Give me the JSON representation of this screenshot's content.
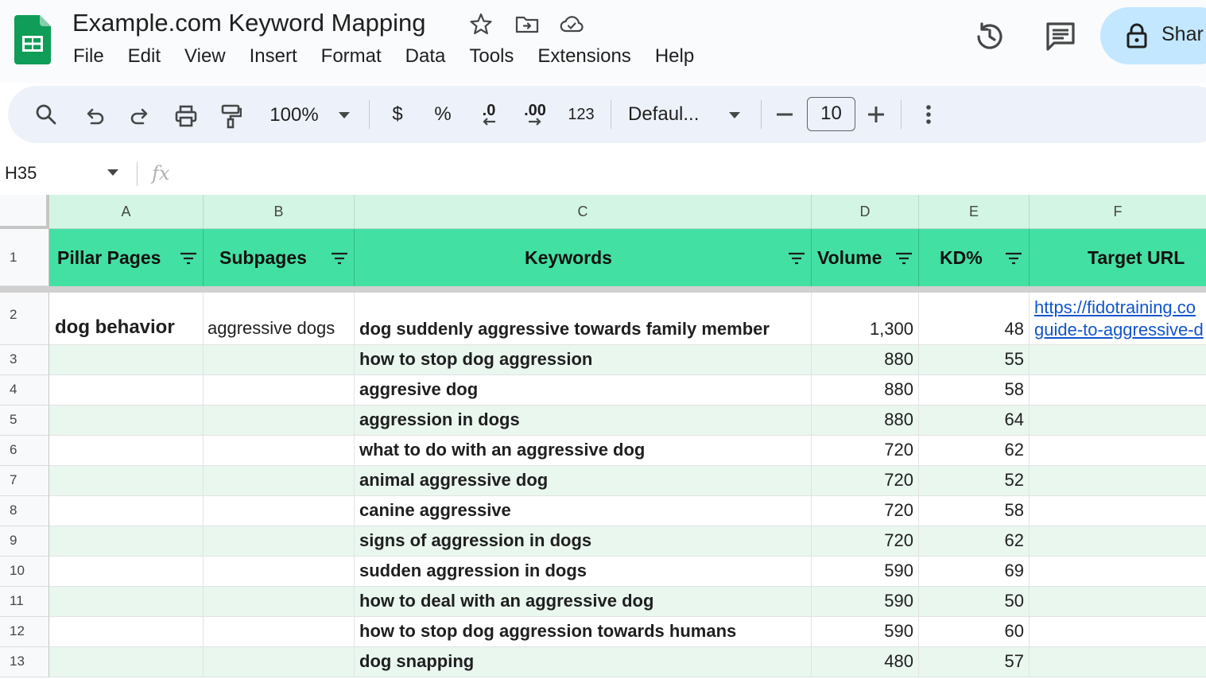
{
  "app": {
    "doc_title": "Example.com Keyword Mapping",
    "menu": [
      "File",
      "Edit",
      "View",
      "Insert",
      "Format",
      "Data",
      "Tools",
      "Extensions",
      "Help"
    ],
    "share_label": "Shar",
    "brand_color": "#0f9d58",
    "accent_color": "#c2e7ff"
  },
  "toolbar": {
    "zoom": "100%",
    "currency": "$",
    "percent": "%",
    "decrease_decimal": ".0",
    "increase_decimal": ".00",
    "more_formats": "123",
    "font": "Defaul...",
    "font_size": "10",
    "icons": [
      "search-icon",
      "undo-icon",
      "redo-icon",
      "print-icon",
      "paint-format-icon",
      "chevron-down-icon",
      "minus-icon",
      "plus-icon",
      "more-vert-icon"
    ]
  },
  "formula_bar": {
    "cell_ref": "H35",
    "fx": "fx",
    "value": ""
  },
  "sheet": {
    "columns": [
      "A",
      "B",
      "C",
      "D",
      "E",
      "F"
    ],
    "header_color": "#43e0a3",
    "headers": {
      "a": "Pillar Pages",
      "b": "Subpages",
      "c": "Keywords",
      "d": "Volume",
      "e": "KD%",
      "f": "Target URL"
    },
    "rows": [
      {
        "num": "1"
      },
      {
        "num": "2",
        "pillar": "dog behavior",
        "subpage": "aggressive dogs",
        "keyword": "dog suddenly aggressive towards family member",
        "volume": "1,300",
        "kd": "48",
        "url_line1": "https://fidotraining.co",
        "url_line2": "guide-to-aggressive-d"
      },
      {
        "num": "3",
        "keyword": "how to stop dog aggression",
        "volume": "880",
        "kd": "55"
      },
      {
        "num": "4",
        "keyword": "aggresive dog",
        "volume": "880",
        "kd": "58"
      },
      {
        "num": "5",
        "keyword": "aggression in dogs",
        "volume": "880",
        "kd": "64"
      },
      {
        "num": "6",
        "keyword": "what to do with an aggressive dog",
        "volume": "720",
        "kd": "62"
      },
      {
        "num": "7",
        "keyword": "animal aggressive dog",
        "volume": "720",
        "kd": "52"
      },
      {
        "num": "8",
        "keyword": "canine aggressive",
        "volume": "720",
        "kd": "58"
      },
      {
        "num": "9",
        "keyword": "signs of aggression in dogs",
        "volume": "720",
        "kd": "62"
      },
      {
        "num": "10",
        "keyword": "sudden aggression in dogs",
        "volume": "590",
        "kd": "69"
      },
      {
        "num": "11",
        "keyword": "how to deal with an aggressive dog",
        "volume": "590",
        "kd": "50"
      },
      {
        "num": "12",
        "keyword": "how to stop dog aggression towards humans",
        "volume": "590",
        "kd": "60"
      },
      {
        "num": "13",
        "keyword": "dog snapping",
        "volume": "480",
        "kd": "57"
      }
    ]
  }
}
